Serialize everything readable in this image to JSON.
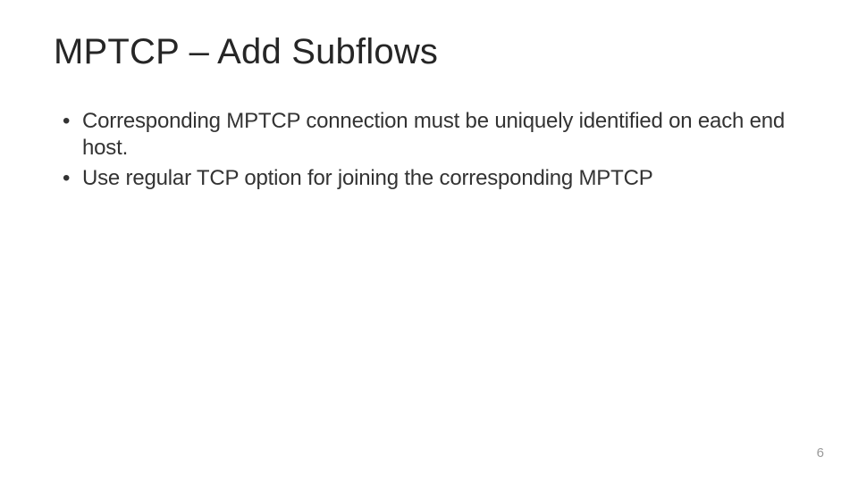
{
  "slide": {
    "title": "MPTCP – Add Subflows",
    "bullets": [
      "Corresponding MPTCP connection must be uniquely identified on each end host.",
      "Use regular TCP option for joining the corresponding MPTCP"
    ],
    "page_number": "6"
  }
}
